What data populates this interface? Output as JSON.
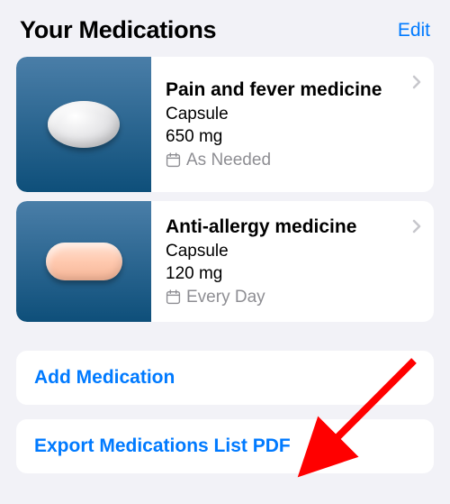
{
  "header": {
    "title": "Your Medications",
    "edit_label": "Edit"
  },
  "medications": [
    {
      "name": "Pain and fever medicine",
      "form": "Capsule",
      "dose": "650 mg",
      "schedule": "As Needed",
      "pill_shape": "oval",
      "pill_color": "#e8e8ea"
    },
    {
      "name": "Anti-allergy medicine",
      "form": "Capsule",
      "dose": "120 mg",
      "schedule": "Every Day",
      "pill_shape": "capsule",
      "pill_color": "#ffc9af"
    }
  ],
  "actions": {
    "add_label": "Add Medication",
    "export_label": "Export Medications List PDF"
  },
  "colors": {
    "accent": "#007aff",
    "background": "#f2f2f7",
    "secondary_text": "#8e8e93",
    "annotation_arrow": "#ff0000"
  }
}
